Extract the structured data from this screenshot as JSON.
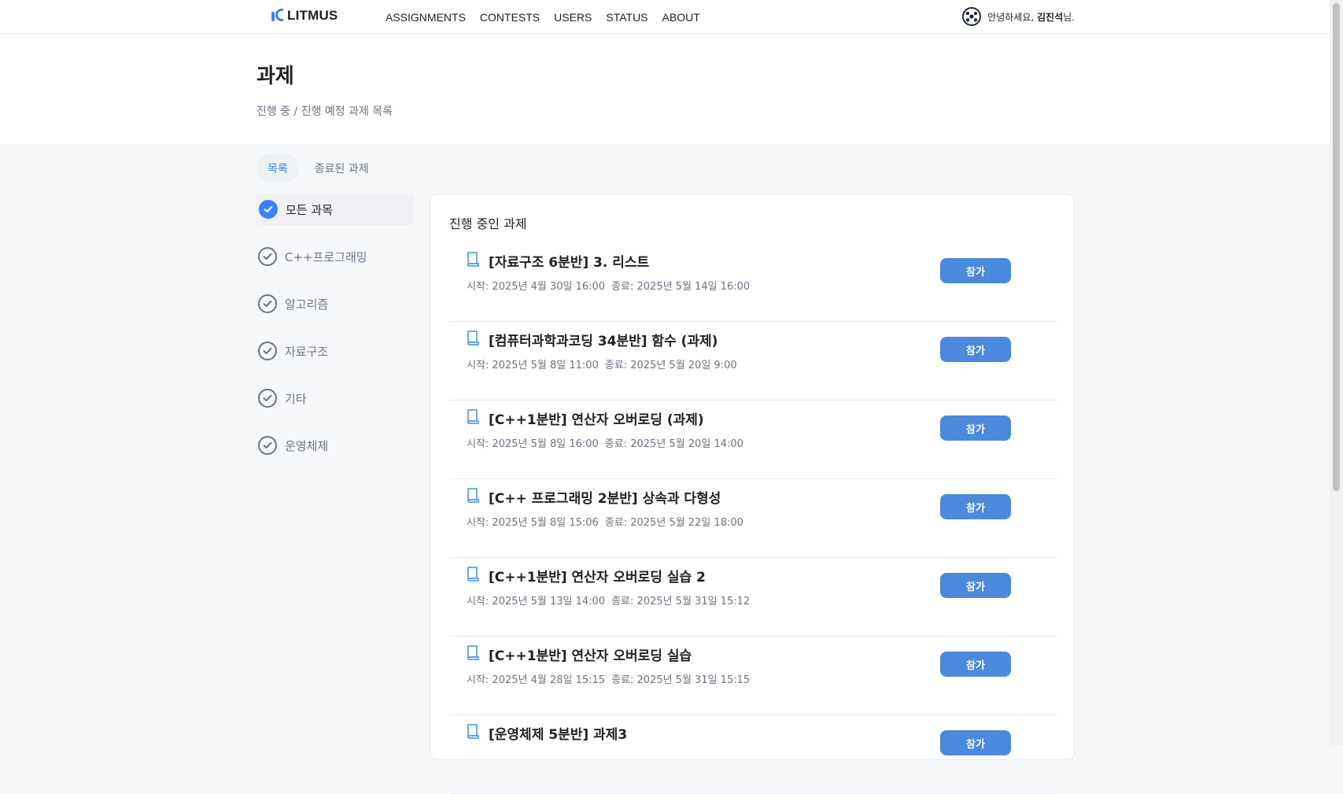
{
  "nav": {
    "brand": "LITMUS",
    "items": [
      "ASSIGNMENTS",
      "CONTESTS",
      "USERS",
      "STATUS",
      "ABOUT"
    ],
    "greeting_prefix": "안녕하세요,",
    "username": "김진석",
    "greeting_suffix": "님."
  },
  "header": {
    "title": "과제",
    "subtitle": "진행 중 / 진행 예정 과제 목록"
  },
  "tabs": [
    {
      "label": "목록",
      "active": true
    },
    {
      "label": "종료된 과제",
      "active": false
    }
  ],
  "sidebar": {
    "items": [
      {
        "label": "모든 과목",
        "active": true
      },
      {
        "label": "C++프로그래밍",
        "active": false
      },
      {
        "label": "알고리즘",
        "active": false
      },
      {
        "label": "자료구조",
        "active": false
      },
      {
        "label": "기타",
        "active": false
      },
      {
        "label": "운영체제",
        "active": false
      }
    ]
  },
  "panel": {
    "title": "진행 중인 과제",
    "join_label": "참가",
    "assignments": [
      {
        "name": "[자료구조 6분반] 3. 리스트",
        "start": "시작: 2025년 4월 30일 16:00",
        "end": "종료: 2025년 5월 14일 16:00"
      },
      {
        "name": "[컴퓨터과학과코딩 34분반] 함수 (과제)",
        "start": "시작: 2025년 5월 8일 11:00",
        "end": "종료: 2025년 5월 20일 9:00"
      },
      {
        "name": "[C++1분반] 연산자 오버로딩 (과제)",
        "start": "시작: 2025년 5월 8일 16:00",
        "end": "종료: 2025년 5월 20일 14:00"
      },
      {
        "name": "[C++ 프로그래밍 2분반] 상속과 다형성",
        "start": "시작: 2025년 5월 8일 15:06",
        "end": "종료: 2025년 5월 22일 18:00"
      },
      {
        "name": "[C++1분반] 연산자 오버로딩 실습 2",
        "start": "시작: 2025년 5월 13일 14:00",
        "end": "종료: 2025년 5월 31일 15:12"
      },
      {
        "name": "[C++1분반] 연산자 오버로딩 실습",
        "start": "시작: 2025년 4월 28일 15:15",
        "end": "종료: 2025년 5월 31일 15:15"
      },
      {
        "name": "[운영체제 5분반] 과제3",
        "start": "",
        "end": ""
      }
    ]
  },
  "colors": {
    "accent": "#3b82f6",
    "button": "#4a89dc"
  }
}
